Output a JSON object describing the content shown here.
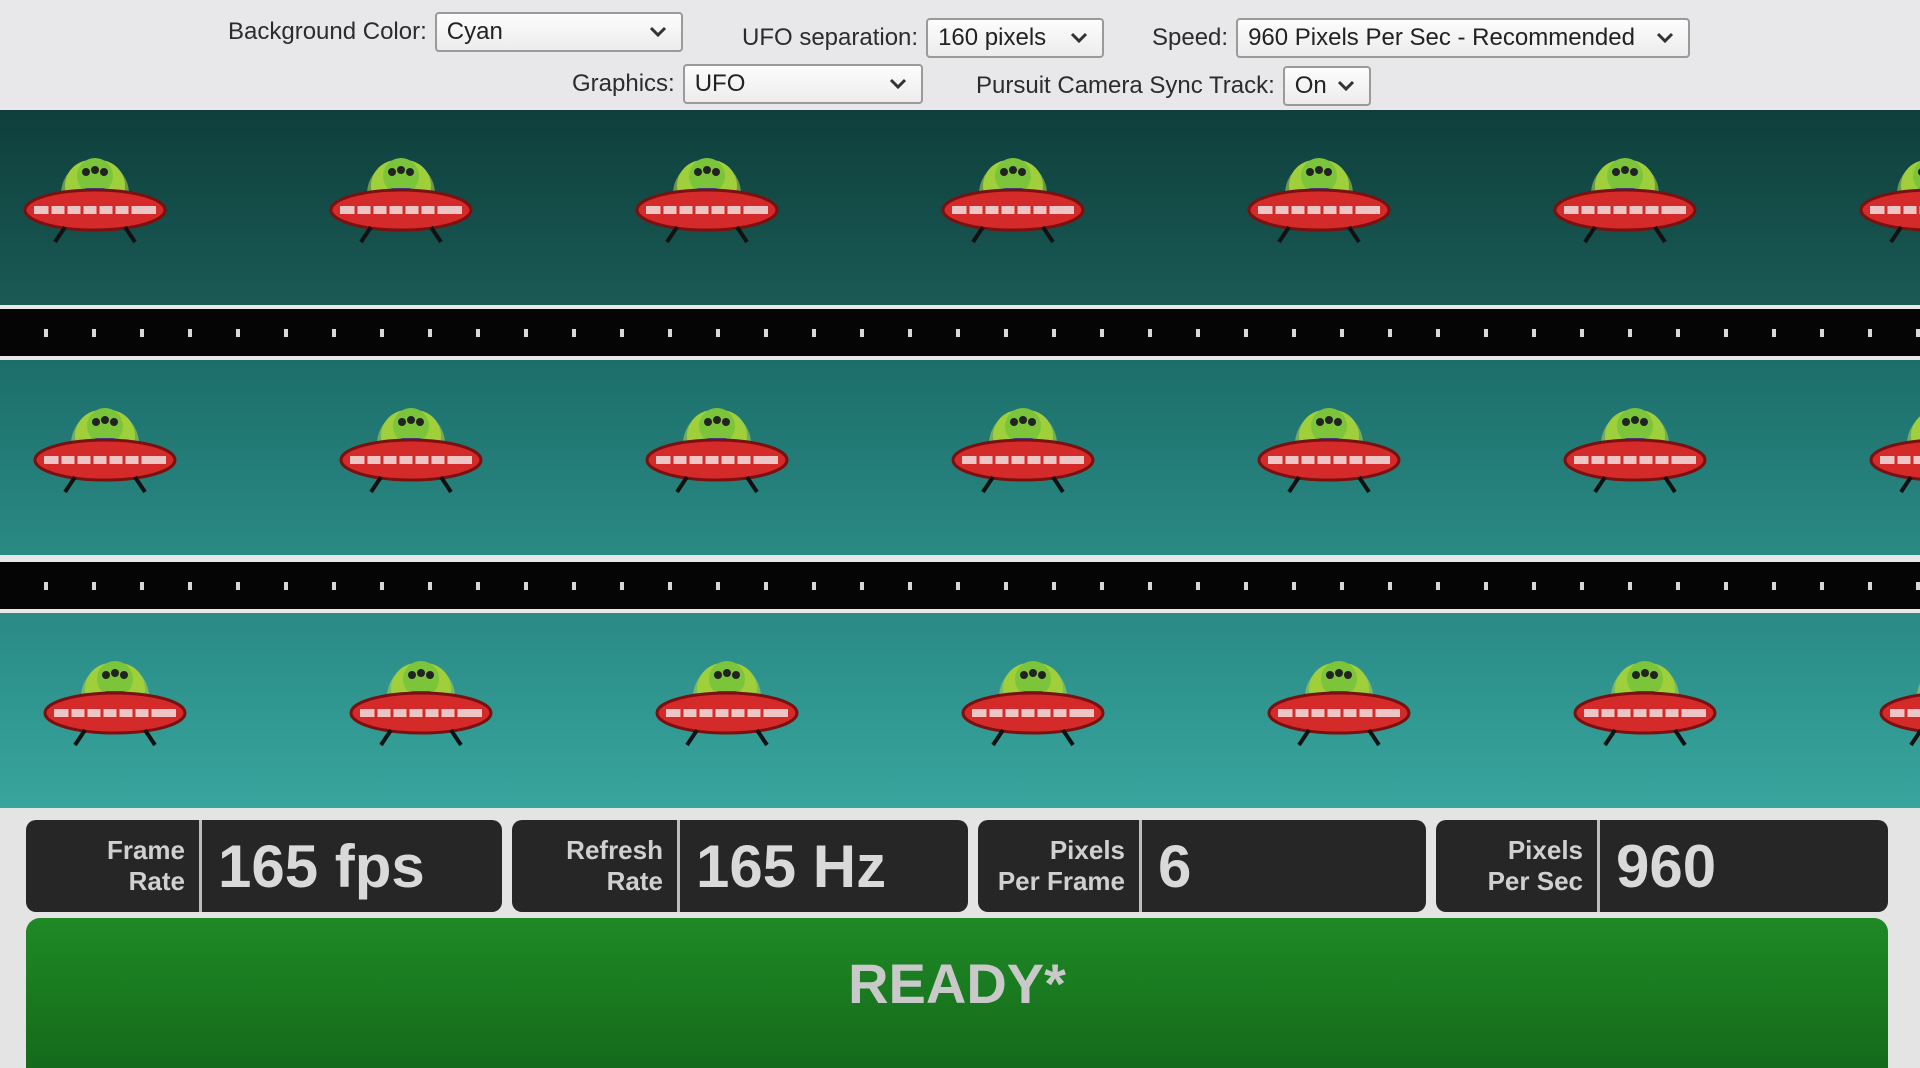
{
  "controls": {
    "background_color": {
      "label": "Background Color:",
      "value": "Cyan"
    },
    "ufo_separation": {
      "label": "UFO separation:",
      "value": "160 pixels"
    },
    "speed": {
      "label": "Speed:",
      "value": "960 Pixels Per Sec - Recommended"
    },
    "graphics": {
      "label": "Graphics:",
      "value": "UFO"
    },
    "pursuit_camera_sync_track": {
      "label": "Pursuit Camera Sync Track:",
      "value": "On"
    }
  },
  "stats": {
    "frame_rate": {
      "label_line1": "Frame",
      "label_line2": "Rate",
      "value": "165 fps"
    },
    "refresh_rate": {
      "label_line1": "Refresh",
      "label_line2": "Rate",
      "value": "165 Hz"
    },
    "pixels_per_frame": {
      "label_line1": "Pixels",
      "label_line2": "Per Frame",
      "value": "6"
    },
    "pixels_per_sec": {
      "label_line1": "Pixels",
      "label_line2": "Per Sec",
      "value": "960"
    }
  },
  "status": {
    "text": "READY*"
  },
  "icons": {
    "ufo": "ufo-alien-icon",
    "dropdown": "chevron-down-icon"
  },
  "colors": {
    "lane_dark": "#0e3f3c",
    "lane_mid": "#1c6e6a",
    "lane_light": "#2a8a85",
    "ufo_saucer": "#d42a2a",
    "alien": "#7fc73a",
    "status_ready": "#1f8a25"
  }
}
